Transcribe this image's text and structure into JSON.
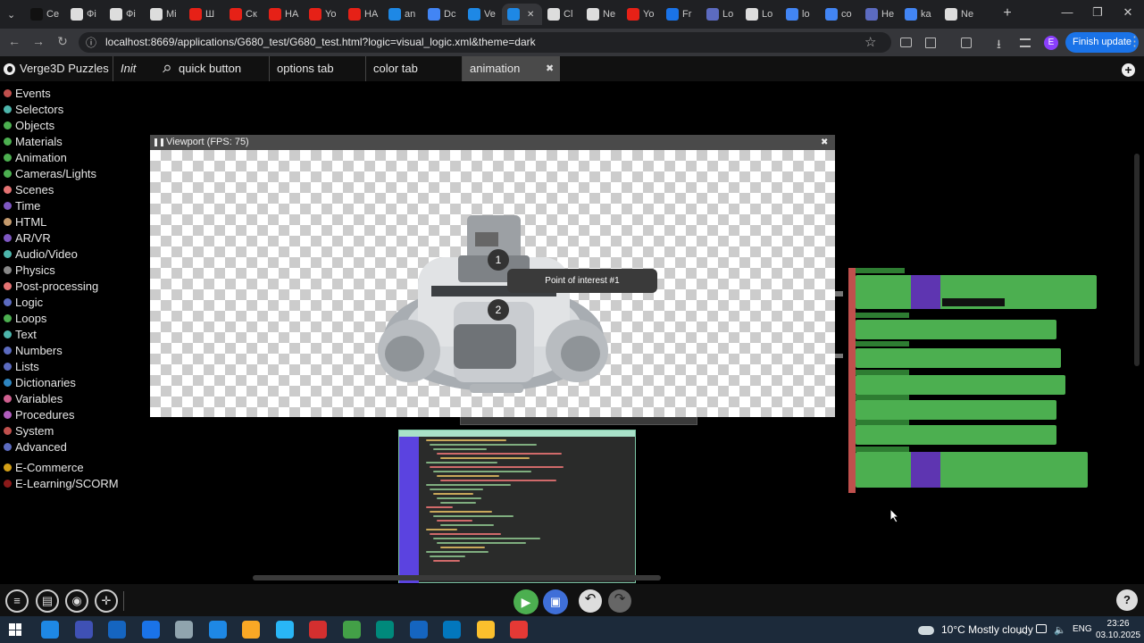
{
  "browser": {
    "tabs": [
      {
        "label": "Ce",
        "color": "#111"
      },
      {
        "label": "Фі",
        "color": "#ddd"
      },
      {
        "label": "Фі",
        "color": "#ddd"
      },
      {
        "label": "Mi",
        "color": "#ddd"
      },
      {
        "label": "Ш",
        "color": "#e62117"
      },
      {
        "label": "Ск",
        "color": "#e62117"
      },
      {
        "label": "HA",
        "color": "#e62117"
      },
      {
        "label": "Yo",
        "color": "#e62117"
      },
      {
        "label": "HA",
        "color": "#e62117"
      },
      {
        "label": "an",
        "color": "#1e88e5"
      },
      {
        "label": "Dc",
        "color": "#4285f4"
      },
      {
        "label": "Ve",
        "color": "#1e88e5"
      },
      {
        "label": "",
        "color": "#1e88e5",
        "active": true
      },
      {
        "label": "Cl",
        "color": "#ddd"
      },
      {
        "label": "Ne",
        "color": "#ddd"
      },
      {
        "label": "Yo",
        "color": "#e62117"
      },
      {
        "label": "Fr",
        "color": "#1a73e8"
      },
      {
        "label": "Lo",
        "color": "#5c6bc0"
      },
      {
        "label": "Lo",
        "color": "#ddd"
      },
      {
        "label": "lo",
        "color": "#4285f4"
      },
      {
        "label": "co",
        "color": "#4285f4"
      },
      {
        "label": "He",
        "color": "#5c6bc0"
      },
      {
        "label": "ka",
        "color": "#4285f4"
      },
      {
        "label": "Ne",
        "color": "#ddd"
      }
    ],
    "url": "localhost:8669/applications/G680_test/G680_test.html?logic=visual_logic.xml&theme=dark",
    "profile_initial": "E",
    "finish_update": "Finish update",
    "new_tab_symbol": "+",
    "minimize_symbol": "—",
    "restore_symbol": "❐",
    "close_symbol": "✕",
    "back_symbol": "←",
    "forward_symbol": "→",
    "reload_symbol": "↻",
    "site_info_symbol": "ⓘ",
    "star_symbol": "☆",
    "download_symbol": "⭳",
    "more_symbol": "⋮"
  },
  "app": {
    "title": "Verge3D Puzzles",
    "tabs": [
      {
        "label": "Init",
        "italic": true
      },
      {
        "label": "quick button"
      },
      {
        "label": "options tab"
      },
      {
        "label": "color tab"
      },
      {
        "label": "animation",
        "active": true
      }
    ],
    "pin_symbol": "📌",
    "close_tab_symbol": "✖",
    "add_tab_symbol": "+"
  },
  "sidebar": {
    "categories": [
      {
        "label": "Events",
        "color": "#c0504d"
      },
      {
        "label": "Selectors",
        "color": "#4db6ac"
      },
      {
        "label": "Objects",
        "color": "#4caf50"
      },
      {
        "label": "Materials",
        "color": "#4caf50"
      },
      {
        "label": "Animation",
        "color": "#4caf50"
      },
      {
        "label": "Cameras/Lights",
        "color": "#4caf50"
      },
      {
        "label": "Scenes",
        "color": "#e57373"
      },
      {
        "label": "Time",
        "color": "#7e57c2"
      },
      {
        "label": "HTML",
        "color": "#c49a6c"
      },
      {
        "label": "AR/VR",
        "color": "#7e57c2"
      },
      {
        "label": "Audio/Video",
        "color": "#4db6ac"
      },
      {
        "label": "Physics",
        "color": "#888888"
      },
      {
        "label": "Post-processing",
        "color": "#e57373"
      },
      {
        "label": "Logic",
        "color": "#5c6bc0"
      },
      {
        "label": "Loops",
        "color": "#4caf50"
      },
      {
        "label": "Text",
        "color": "#4db6ac"
      },
      {
        "label": "Numbers",
        "color": "#5c6bc0"
      },
      {
        "label": "Lists",
        "color": "#5c6bc0"
      },
      {
        "label": "Dictionaries",
        "color": "#2e86c1"
      },
      {
        "label": "Variables",
        "color": "#d06090"
      },
      {
        "label": "Procedures",
        "color": "#b05dbd"
      },
      {
        "label": "System",
        "color": "#c0504d"
      },
      {
        "label": "Advanced",
        "color": "#5c6bc0"
      }
    ],
    "extra_categories": [
      {
        "label": "E-Commerce",
        "color": "#d4a017"
      },
      {
        "label": "E-Learning/SCORM",
        "color": "#8b1a1a"
      }
    ]
  },
  "viewport": {
    "title": "Viewport (FPS: 75)",
    "poi_1": "1",
    "poi_2": "2",
    "poi_label": "Point of interest #1",
    "close_symbol": "✖"
  },
  "bottombar": {
    "buttons": [
      "list-icon",
      "document-icon",
      "camera-icon",
      "target-icon"
    ],
    "run_icon": "play-icon",
    "save_icon": "save-icon",
    "undo_icon": "undo-icon",
    "redo_icon": "redo-icon",
    "help_symbol": "?"
  },
  "taskbar": {
    "weather": "10°C  Mostly cloudy",
    "lang": "ENG",
    "time": "23:26",
    "date": "03.10.2025",
    "icons": [
      "#1e88e5",
      "#3f51b5",
      "#1565c0",
      "#1a73e8",
      "#90a4ae",
      "#1e88e5",
      "#f9a825",
      "#29b6f6",
      "#d32f2f",
      "#43a047",
      "#00897b",
      "#1565c0",
      "#0277bd",
      "#fbc02d",
      "#e53935"
    ]
  }
}
